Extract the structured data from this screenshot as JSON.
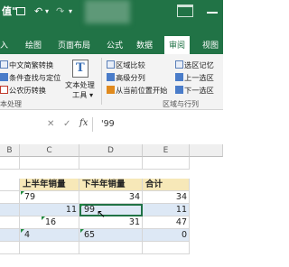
{
  "app": {
    "title_fragment": "值\"",
    "quick_access": {
      "save_icon": "save-icon",
      "undo_icon": "undo-icon",
      "redo_icon": "redo-icon"
    },
    "accent_color": "#217346"
  },
  "tabs": [
    {
      "label": "入"
    },
    {
      "label": "绘图"
    },
    {
      "label": "页面布局"
    },
    {
      "label": "公式"
    },
    {
      "label": "数据"
    },
    {
      "label": "审阅"
    },
    {
      "label": "视图"
    }
  ],
  "ribbon": {
    "text_group": {
      "items": [
        "中文简繁转换",
        "条件查找与定位",
        "公农历转换"
      ],
      "big_tool": {
        "line1": "文本处理",
        "line2": "工具"
      },
      "label": "本处理"
    },
    "region_group": {
      "left_items": [
        "区域比较",
        "高级分列",
        "从当前位置开始"
      ],
      "right_items": [
        "选区记忆",
        "上一选区",
        "下一选区"
      ],
      "label": "区域与行列"
    }
  },
  "formula_bar": {
    "cancel": "✕",
    "enter": "✓",
    "fx": "fx",
    "value": "'99"
  },
  "sheet": {
    "columns": [
      "B",
      "C",
      "D",
      "E"
    ],
    "header_row": [
      "",
      "上半年销量",
      "下半年销量",
      "合计"
    ],
    "rows": [
      {
        "c": "79",
        "d": "34",
        "e": "34"
      },
      {
        "c": "11",
        "d": "99",
        "e": "11"
      },
      {
        "c": "16",
        "d": "31",
        "e": "47"
      },
      {
        "c": "4",
        "d": "65",
        "e": "0"
      }
    ]
  }
}
